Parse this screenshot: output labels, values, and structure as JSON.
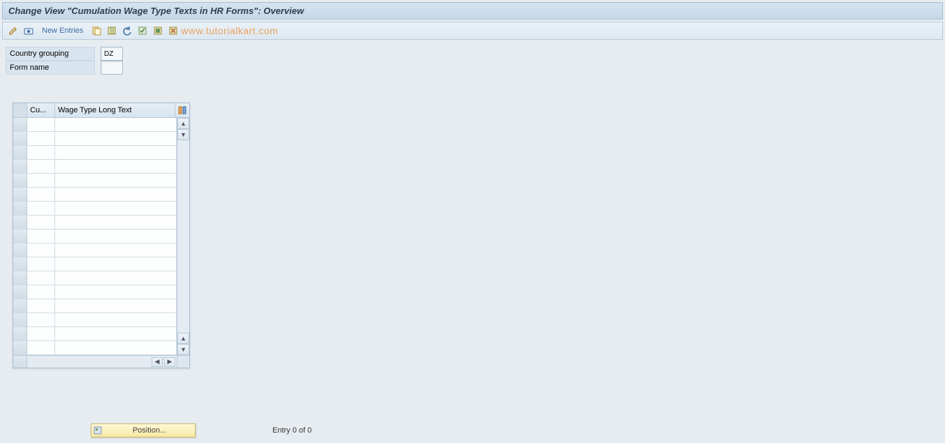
{
  "title": "Change View \"Cumulation Wage Type Texts in HR Forms\": Overview",
  "toolbar": {
    "new_entries_label": "New Entries",
    "watermark": "www.tutorialkart.com"
  },
  "form": {
    "country_grouping_label": "Country grouping",
    "country_grouping_value": "DZ",
    "form_name_label": "Form name",
    "form_name_value": ""
  },
  "table": {
    "col_cu": "Cu...",
    "col_wage": "Wage Type Long Text",
    "row_count": 17
  },
  "footer": {
    "position_label": "Position...",
    "entry_text": "Entry 0 of 0"
  }
}
